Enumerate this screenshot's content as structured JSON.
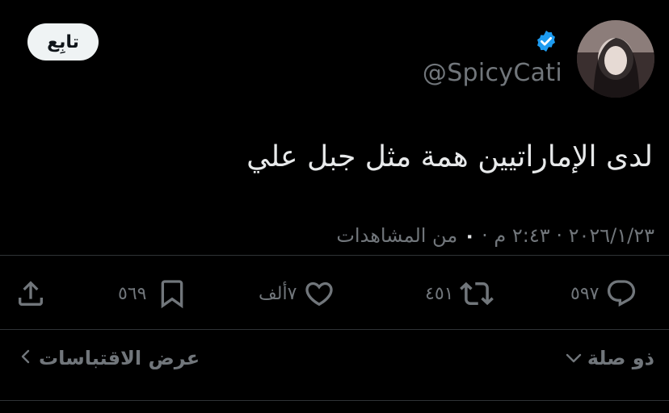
{
  "user": {
    "handle": "@SpicyCati",
    "verified": true,
    "verified_color": "#1d9bf0"
  },
  "follow_label": "تابِع",
  "tweet": {
    "text": "لدى الإماراتيين همة مثل جبل علي",
    "date": "٢٠٢٦/١/٢٣",
    "separator": "·",
    "time": "٢:٤٣ م",
    "views_count": "٠",
    "views_label": "من المشاهدات"
  },
  "actions": {
    "replies": "٥٩٧",
    "reposts": "٤٥١",
    "likes": "٧ألف",
    "bookmarks": "٥٦٩"
  },
  "footer": {
    "quotes_label": "عرض الاقتباسات",
    "related_label": "ذو صلة"
  },
  "icons": {
    "reply": "reply-icon",
    "repost": "repost-icon",
    "like": "heart-icon",
    "bookmark": "bookmark-icon",
    "share": "share-icon"
  },
  "colors": {
    "background": "#000000",
    "text": "#e7e9ea",
    "muted": "#71767b"
  }
}
